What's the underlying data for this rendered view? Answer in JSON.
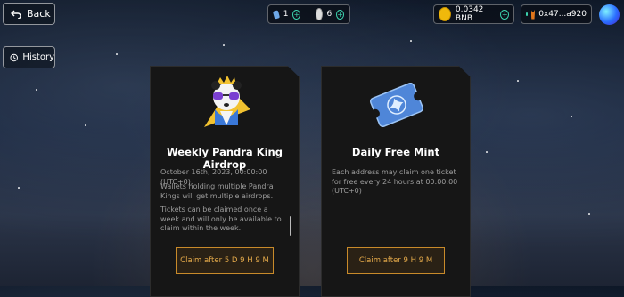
{
  "header": {
    "back_label": "Back",
    "ticket_count": "1",
    "panda_count": "6",
    "bnb_balance": "0.0342 BNB",
    "wallet_address": "0x47...a920"
  },
  "sidebar": {
    "history_label": "History"
  },
  "cards": [
    {
      "title": "Weekly Pandra King Airdrop",
      "date": "October 16th, 2023, 00:00:00 (UTC+0).",
      "text1": "Wallets holding multiple Pandra Kings will get multiple airdrops.",
      "text2": "Tickets can be claimed once a week and will only be available to claim within the week.",
      "button": "Claim after 5 D 9 H 9 M"
    },
    {
      "title": "Daily Free Mint",
      "text1": "Each address may claim one ticket for free every 24 hours at 00:00:00 (UTC+0)",
      "button": "Claim after 9 H 9 M"
    }
  ],
  "colors": {
    "accent_orange": "#e3a94a",
    "plus_teal": "#3dd6b0",
    "bnb_gold": "#f0b90b"
  }
}
